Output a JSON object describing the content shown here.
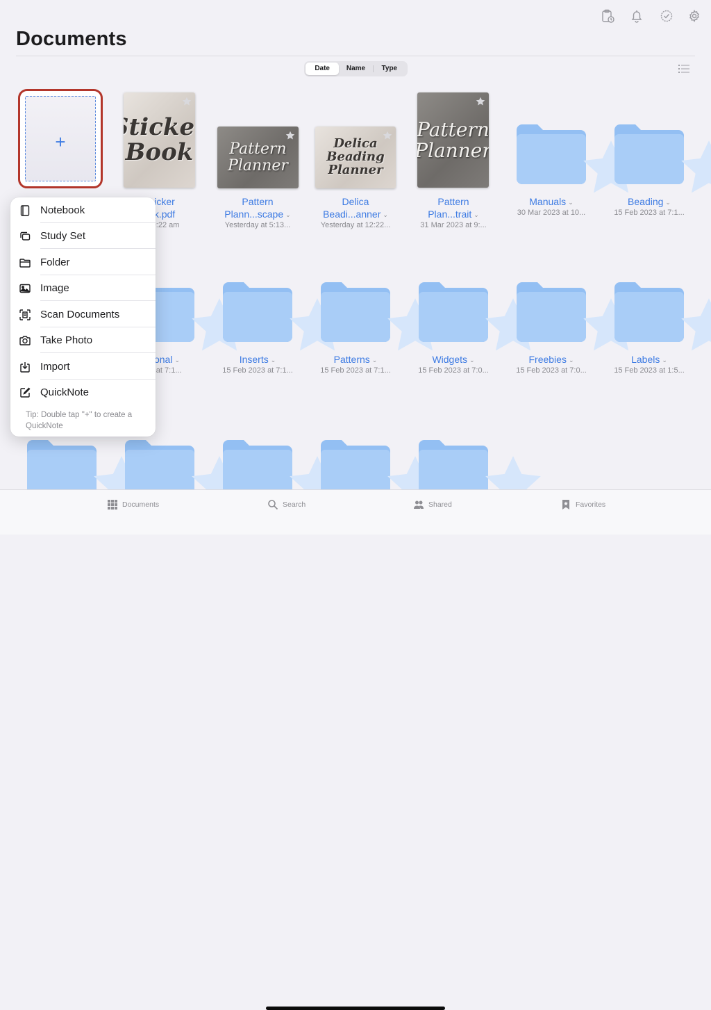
{
  "header": {
    "title": "Documents",
    "sort_tabs": [
      "Date",
      "Name",
      "Type"
    ],
    "active_sort": "Date"
  },
  "new_document": {
    "plus_label": "+"
  },
  "documents": [
    {
      "title": "…icker\n…k.pdf",
      "title_line1": "…icker",
      "title_line2": "…k.pdf",
      "subtitle": "…t 9:22 am",
      "cover_text": "Sticker Book"
    },
    {
      "title_line1": "Pattern",
      "title_line2": "Plann...scape",
      "subtitle": "Yesterday at 5:13...",
      "cover_text": "Pattern Planner"
    },
    {
      "title_line1": "Delica",
      "title_line2": "Beadi...anner",
      "subtitle": "Yesterday at 12:22...",
      "cover_text": "Delica Beading Planner"
    },
    {
      "title_line1": "Pattern",
      "title_line2": "Plan...trait",
      "subtitle": "31 Mar 2023 at 9:...",
      "cover_text": "Pattern Planner"
    }
  ],
  "folders_row1": [
    {
      "title": "Manuals",
      "subtitle": "30 Mar 2023 at 10..."
    },
    {
      "title": "Beading",
      "subtitle": "15 Feb 2023 at 7:1..."
    }
  ],
  "folders_row2": [
    {
      "title": "…sonal",
      "subtitle": "…23 at 7:1..."
    },
    {
      "title": "Inserts",
      "subtitle": "15 Feb 2023 at 7:1..."
    },
    {
      "title": "Patterns",
      "subtitle": "15 Feb 2023 at 7:1..."
    },
    {
      "title": "Widgets",
      "subtitle": "15 Feb 2023 at 7:0..."
    },
    {
      "title": "Freebies",
      "subtitle": "15 Feb 2023 at 7:0..."
    },
    {
      "title": "Labels",
      "subtitle": "15 Feb 2023 at 1:5..."
    }
  ],
  "create_menu": {
    "items": [
      {
        "label": "Notebook",
        "icon": "notebook-icon"
      },
      {
        "label": "Study Set",
        "icon": "study-set-icon"
      },
      {
        "label": "Folder",
        "icon": "folder-icon"
      },
      {
        "label": "Image",
        "icon": "image-icon"
      },
      {
        "label": "Scan Documents",
        "icon": "scan-icon"
      },
      {
        "label": "Take Photo",
        "icon": "camera-icon"
      },
      {
        "label": "Import",
        "icon": "import-icon"
      },
      {
        "label": "QuickNote",
        "icon": "quicknote-icon"
      }
    ],
    "tip": "Tip: Double tap \"+\" to create a QuickNote"
  },
  "tabbar": {
    "tabs": [
      {
        "label": "Documents",
        "icon": "grid-icon"
      },
      {
        "label": "Search",
        "icon": "search-icon"
      },
      {
        "label": "Shared",
        "icon": "people-icon"
      },
      {
        "label": "Favorites",
        "icon": "bookmark-star-icon"
      }
    ]
  },
  "colors": {
    "accent": "#3d7be3",
    "folder": "#a9cdf7",
    "selection_border": "#b3362b",
    "background": "#f2f1f6"
  }
}
